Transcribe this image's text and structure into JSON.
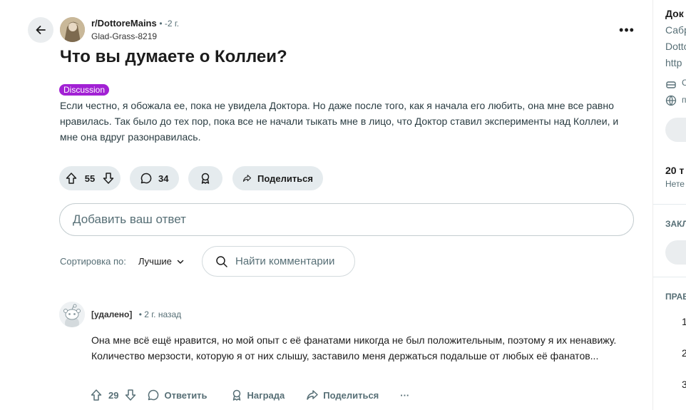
{
  "post": {
    "subreddit": "r/DottoreMains",
    "age": "• -2 г.",
    "author": "Glad-Grass-8219",
    "title": "Что вы думаете о Коллеи?",
    "flair": "Discussion",
    "body": "Если честно, я обожала ее, пока не увидела Доктора. Но даже после того, как я начала его любить, она мне все равно нравилась. Так было до тех пор, пока все не начали тыкать мне в лицо, что Доктор ставил эксперименты над Коллеи, и мне она вдруг разонравилась.",
    "score": "55",
    "comments_count": "34",
    "share_label": "Поделиться",
    "more": "•••"
  },
  "reply": {
    "placeholder": "Добавить ваш ответ"
  },
  "sort": {
    "label": "Сортировка по:",
    "value": "Лучшие",
    "search_placeholder": "Найти комментарии"
  },
  "comment": {
    "author": "[удалено]",
    "time": "• 2 г. назад",
    "text": "Она мне всё ещё нравится, но мой опыт с её фанатами никогда не был положительным, поэтому я их ненавижу. Количество мерзости, которую я от них слышу, заставило меня держаться подальше от любых её фанатов...",
    "score": "29",
    "reply_label": "Ответить",
    "award_label": "Награда",
    "share_label": "Поделиться",
    "more": "···"
  },
  "sidebar": {
    "title": "Док",
    "desc1": "Сабр",
    "desc2": "Dotto",
    "desc3": "http",
    "meta1": "С",
    "meta2": "п",
    "members": "20 т",
    "members_sub": "Нете",
    "section1": "ЗАКЛ",
    "section2": "ПРАВ",
    "rule1": "1",
    "rule2": "2",
    "rule3": "3"
  },
  "colors": {
    "flair_bg": "#a221d4",
    "pill_bg": "#e5ebee",
    "muted": "#576f76"
  },
  "icons": [
    "back-arrow-icon",
    "upvote-icon",
    "downvote-icon",
    "comment-icon",
    "award-icon",
    "share-icon",
    "search-icon",
    "chevron-down-icon"
  ]
}
